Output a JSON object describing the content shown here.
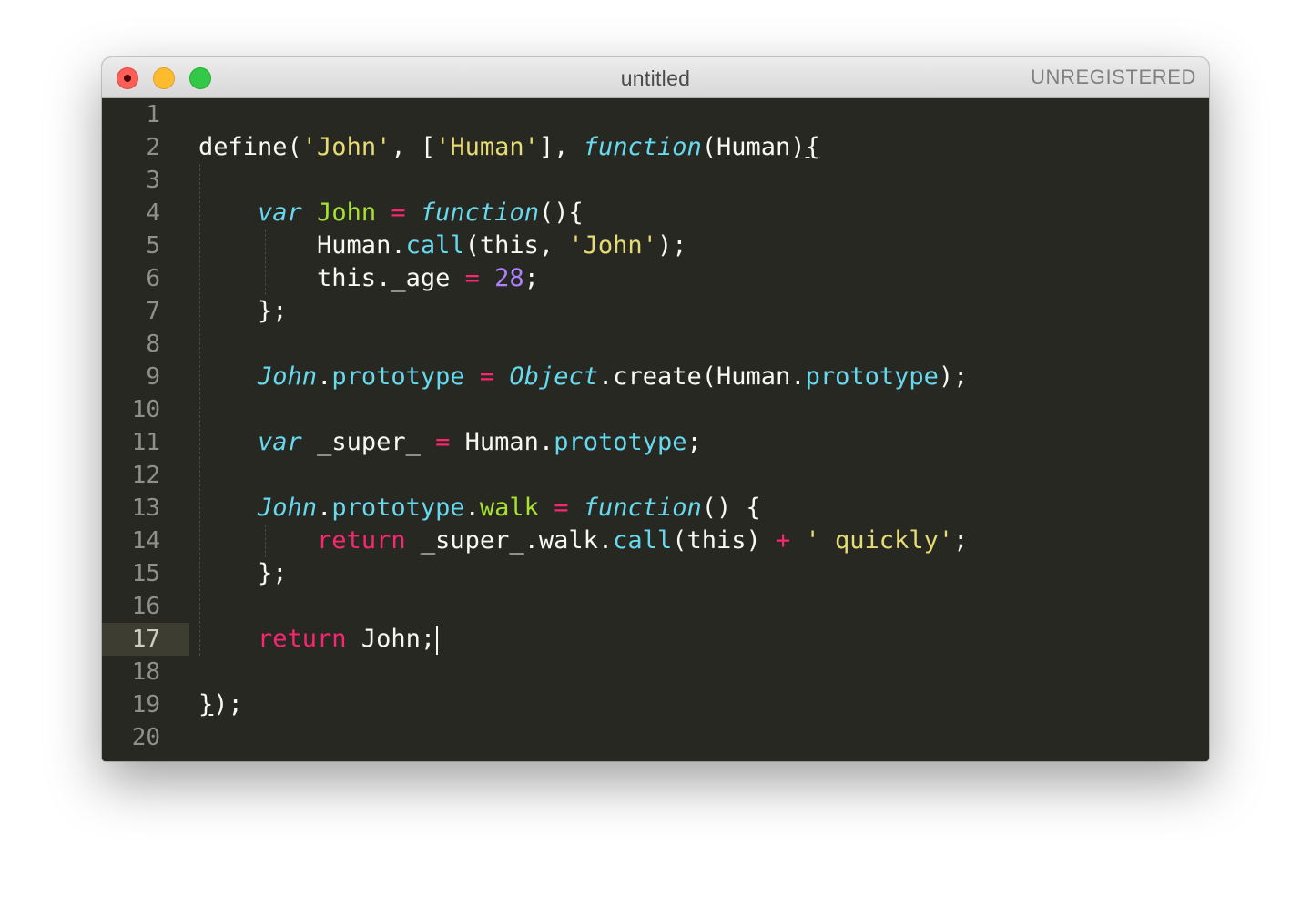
{
  "window": {
    "title": "untitled",
    "registration_status": "UNREGISTERED"
  },
  "colors": {
    "background": "#272822",
    "text": "#f8f8f2",
    "string": "#e6db74",
    "storage": "#66d9ef",
    "keyword": "#f92672",
    "variable": "#a6e22e",
    "number": "#ae81ff",
    "line_number": "#8f908a",
    "active_line_gutter": "#3e3d32"
  },
  "editor": {
    "active_line": 17,
    "line_numbers": [
      "1",
      "2",
      "3",
      "4",
      "5",
      "6",
      "7",
      "8",
      "9",
      "10",
      "11",
      "12",
      "13",
      "14",
      "15",
      "16",
      "17",
      "18",
      "19",
      "20"
    ],
    "lines": [
      [],
      [
        {
          "t": "define(",
          "c": "plain"
        },
        {
          "t": "'John'",
          "c": "str"
        },
        {
          "t": ", [",
          "c": "plain"
        },
        {
          "t": "'Human'",
          "c": "str"
        },
        {
          "t": "], ",
          "c": "plain"
        },
        {
          "t": "function",
          "c": "storage"
        },
        {
          "t": "(Human)",
          "c": "plain"
        },
        {
          "t": "{",
          "c": "brace-u"
        }
      ],
      [],
      [
        {
          "t": "    ",
          "c": "plain"
        },
        {
          "t": "var",
          "c": "storage"
        },
        {
          "t": " ",
          "c": "plain"
        },
        {
          "t": "John",
          "c": "var"
        },
        {
          "t": " ",
          "c": "plain"
        },
        {
          "t": "=",
          "c": "kw"
        },
        {
          "t": " ",
          "c": "plain"
        },
        {
          "t": "function",
          "c": "storage"
        },
        {
          "t": "(){",
          "c": "plain"
        }
      ],
      [
        {
          "t": "        Human.",
          "c": "plain"
        },
        {
          "t": "call",
          "c": "prop"
        },
        {
          "t": "(this, ",
          "c": "plain"
        },
        {
          "t": "'John'",
          "c": "str"
        },
        {
          "t": ");",
          "c": "plain"
        }
      ],
      [
        {
          "t": "        this._age ",
          "c": "plain"
        },
        {
          "t": "=",
          "c": "kw"
        },
        {
          "t": " ",
          "c": "plain"
        },
        {
          "t": "28",
          "c": "num"
        },
        {
          "t": ";",
          "c": "plain"
        }
      ],
      [
        {
          "t": "    };",
          "c": "plain"
        }
      ],
      [],
      [
        {
          "t": "    ",
          "c": "plain"
        },
        {
          "t": "John",
          "c": "class"
        },
        {
          "t": ".",
          "c": "plain"
        },
        {
          "t": "prototype",
          "c": "prop"
        },
        {
          "t": " ",
          "c": "plain"
        },
        {
          "t": "=",
          "c": "kw"
        },
        {
          "t": " ",
          "c": "plain"
        },
        {
          "t": "Object",
          "c": "class"
        },
        {
          "t": ".create(Human.",
          "c": "plain"
        },
        {
          "t": "prototype",
          "c": "prop"
        },
        {
          "t": ");",
          "c": "plain"
        }
      ],
      [],
      [
        {
          "t": "    ",
          "c": "plain"
        },
        {
          "t": "var",
          "c": "storage"
        },
        {
          "t": " _super_ ",
          "c": "plain"
        },
        {
          "t": "=",
          "c": "kw"
        },
        {
          "t": " Human.",
          "c": "plain"
        },
        {
          "t": "prototype",
          "c": "prop"
        },
        {
          "t": ";",
          "c": "plain"
        }
      ],
      [],
      [
        {
          "t": "    ",
          "c": "plain"
        },
        {
          "t": "John",
          "c": "class"
        },
        {
          "t": ".",
          "c": "plain"
        },
        {
          "t": "prototype",
          "c": "prop"
        },
        {
          "t": ".",
          "c": "plain"
        },
        {
          "t": "walk",
          "c": "var"
        },
        {
          "t": " ",
          "c": "plain"
        },
        {
          "t": "=",
          "c": "kw"
        },
        {
          "t": " ",
          "c": "plain"
        },
        {
          "t": "function",
          "c": "storage"
        },
        {
          "t": "() {",
          "c": "plain"
        }
      ],
      [
        {
          "t": "        ",
          "c": "plain"
        },
        {
          "t": "return",
          "c": "kw"
        },
        {
          "t": " _super_.walk.",
          "c": "plain"
        },
        {
          "t": "call",
          "c": "prop"
        },
        {
          "t": "(this) ",
          "c": "plain"
        },
        {
          "t": "+",
          "c": "kw"
        },
        {
          "t": " ",
          "c": "plain"
        },
        {
          "t": "' quickly'",
          "c": "str"
        },
        {
          "t": ";",
          "c": "plain"
        }
      ],
      [
        {
          "t": "    };",
          "c": "plain"
        }
      ],
      [],
      [
        {
          "t": "    ",
          "c": "plain"
        },
        {
          "t": "return",
          "c": "kw"
        },
        {
          "t": " John;",
          "c": "plain"
        }
      ],
      [],
      [
        {
          "t": "}",
          "c": "brace-u"
        },
        {
          "t": ");",
          "c": "plain"
        }
      ],
      []
    ]
  }
}
